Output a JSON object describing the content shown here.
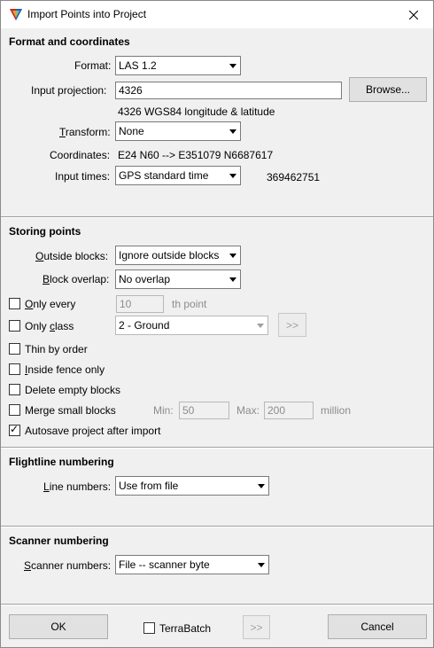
{
  "window": {
    "title": "Import Points into Project"
  },
  "format_section": {
    "title": "Format and coordinates",
    "format_label": "Format:",
    "format_value": "LAS 1.2",
    "projection_label": "Input projection:",
    "projection_value": "4326",
    "browse_label": "Browse...",
    "projection_desc": "4326 WGS84 longitude & latitude",
    "transform_label_u": "T",
    "transform_label_rest": "ransform:",
    "transform_value": "None",
    "coordinates_label": "Coordinates:",
    "coordinates_value": "E24 N60 --> E351079 N6687617",
    "times_label": "Input times:",
    "times_value": "GPS standard time",
    "times_number": "369462751"
  },
  "storing_section": {
    "title": "Storing points",
    "outside_label_u": "O",
    "outside_label_rest": "utside blocks:",
    "outside_value": "Ignore outside blocks",
    "overlap_label_u": "B",
    "overlap_label_rest": "lock overlap:",
    "overlap_value": "No overlap",
    "only_every_u": "O",
    "only_every_rest": "nly every",
    "only_every_value": "10",
    "only_every_suffix": "th point",
    "only_class_pre": "Only ",
    "only_class_u": "c",
    "only_class_rest": "lass",
    "only_class_value": "2 - Ground",
    "class_more": ">>",
    "thin_label": "Thin by order",
    "fence_u": "I",
    "fence_rest": "nside fence only",
    "delete_label": "Delete empty blocks",
    "merge_label": "Merge small blocks",
    "min_label": "Min:",
    "min_value": "50",
    "max_label": "Max:",
    "max_value": "200",
    "million_label": "million",
    "autosave_label": "Autosave project after import"
  },
  "flightline_section": {
    "title": "Flightline numbering",
    "line_u": "L",
    "line_rest": "ine numbers:",
    "line_value": "Use from file"
  },
  "scanner_section": {
    "title": "Scanner numbering",
    "scanner_u": "S",
    "scanner_rest": "canner numbers:",
    "scanner_value": "File -- scanner byte"
  },
  "footer": {
    "ok_label": "OK",
    "terrabatch_label": "TerraBatch",
    "more_label": ">>",
    "cancel_label": "Cancel"
  },
  "checkboxes": {
    "only_every": false,
    "only_class": false,
    "thin_by_order": false,
    "inside_fence": false,
    "delete_empty": false,
    "merge_small": false,
    "autosave": true,
    "terrabatch": false
  }
}
